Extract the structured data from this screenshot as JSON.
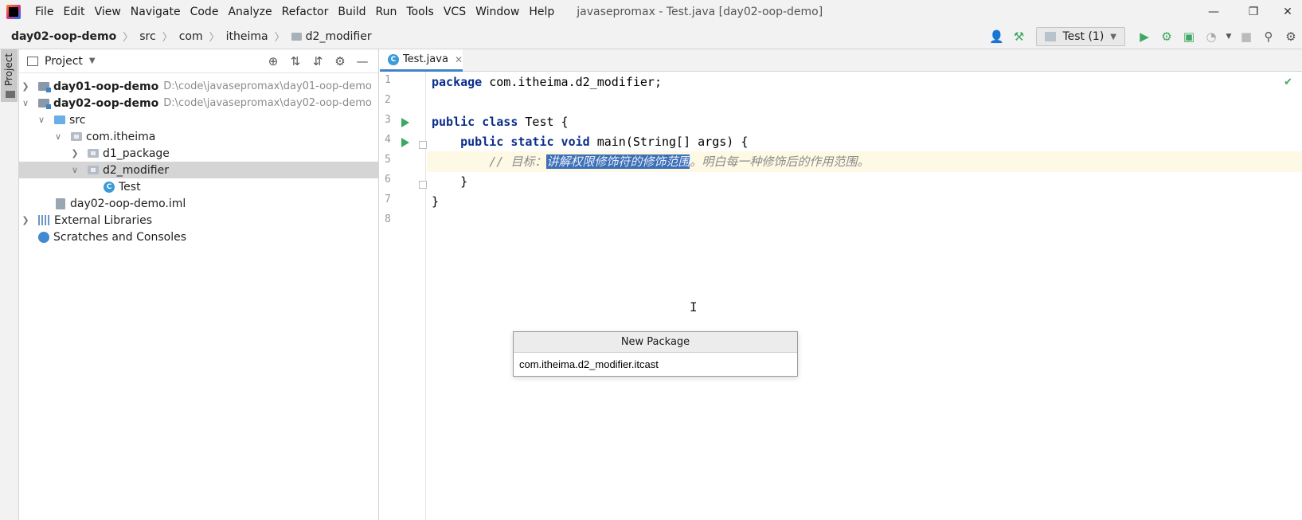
{
  "menubar": {
    "items": [
      "File",
      "Edit",
      "View",
      "Navigate",
      "Code",
      "Analyze",
      "Refactor",
      "Build",
      "Run",
      "Tools",
      "VCS",
      "Window",
      "Help"
    ],
    "window_title": "javasepromax - Test.java [day02-oop-demo]"
  },
  "navbar": {
    "breadcrumbs": [
      "day02-oop-demo",
      "src",
      "com",
      "itheima",
      "d2_modifier"
    ],
    "run_config": "Test (1)"
  },
  "stripe": {
    "label": "Project"
  },
  "project_panel": {
    "title": "Project",
    "tree": [
      {
        "label": "day01-oop-demo",
        "path": "D:\\code\\javasepromax\\day01-oop-demo"
      },
      {
        "label": "day02-oop-demo",
        "path": "D:\\code\\javasepromax\\day02-oop-demo"
      },
      {
        "label": "src"
      },
      {
        "label": "com.itheima"
      },
      {
        "label": "d1_package"
      },
      {
        "label": "d2_modifier"
      },
      {
        "label": "Test"
      },
      {
        "label": "day02-oop-demo.iml"
      },
      {
        "label": "External Libraries"
      },
      {
        "label": "Scratches and Consoles"
      }
    ]
  },
  "editor": {
    "tab_label": "Test.java",
    "line_numbers": [
      "1",
      "2",
      "3",
      "4",
      "5",
      "6",
      "7",
      "8"
    ],
    "code": {
      "l1_kw": "package",
      "l1_rest": " com.itheima.d2_modifier;",
      "l3_kw": "public class",
      "l3_rest": " Test {",
      "l4_kw": "public static void",
      "l4_rest": " main(String[] args) {",
      "l5_comment_pre": "// 目标：",
      "l5_comment_selected": "讲解权限修饰符的修饰范围",
      "l5_comment_post": "。明白每一种修饰后的作用范围。",
      "l6": "    }",
      "l7": "}"
    }
  },
  "popup": {
    "title": "New Package",
    "input_value": "com.itheima.d2_modifier.itcast"
  },
  "colors": {
    "selection": "#3b6fb6",
    "keyword": "#0b2e8a",
    "run_green": "#3da862",
    "tab_underline": "#4083c9"
  }
}
